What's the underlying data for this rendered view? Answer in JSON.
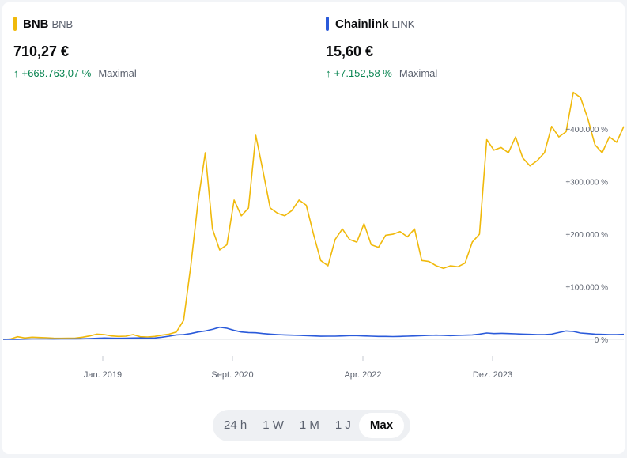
{
  "assets": [
    {
      "name": "BNB",
      "symbol": "BNB",
      "price": "710,27 €",
      "change": "+668.763,07 %",
      "period": "Maximal",
      "color": "#f0b90b"
    },
    {
      "name": "Chainlink",
      "symbol": "LINK",
      "price": "15,60 €",
      "change": "+7.152,58 %",
      "period": "Maximal",
      "color": "#2a5ada"
    }
  ],
  "ranges": [
    "24 h",
    "1 W",
    "1 M",
    "1 J",
    "Max"
  ],
  "active_range": "Max",
  "chart_data": {
    "type": "line",
    "x_tick_labels": [
      "Jan. 2019",
      "Sept. 2020",
      "Apr. 2022",
      "Dez. 2023"
    ],
    "y_tick_labels": [
      "0 %",
      "+100.000 %",
      "+200.000 %",
      "+300.000 %",
      "+400.000 %"
    ],
    "y_ticks": [
      0,
      100000,
      200000,
      300000,
      400000
    ],
    "ylim": [
      0,
      480000
    ],
    "grid": false,
    "series": [
      {
        "name": "BNB",
        "color": "#f0b90b",
        "values": [
          0,
          600,
          5000,
          2500,
          4000,
          3500,
          3000,
          2200,
          2000,
          2100,
          2400,
          4000,
          6500,
          10000,
          9000,
          6500,
          5500,
          6000,
          9000,
          5000,
          4500,
          5500,
          8000,
          10000,
          14000,
          36000,
          140000,
          262000,
          355000,
          210000,
          170000,
          180000,
          265000,
          235000,
          250000,
          388000,
          320000,
          250000,
          240000,
          235000,
          245000,
          265000,
          255000,
          200000,
          150000,
          140000,
          190000,
          210000,
          190000,
          185000,
          220000,
          180000,
          175000,
          198000,
          200000,
          205000,
          195000,
          210000,
          150000,
          148000,
          140000,
          135000,
          140000,
          138000,
          145000,
          185000,
          200000,
          380000,
          360000,
          365000,
          355000,
          385000,
          345000,
          330000,
          340000,
          355000,
          405000,
          385000,
          395000,
          470000,
          460000,
          420000,
          370000,
          355000,
          385000,
          375000,
          405000
        ]
      },
      {
        "name": "Chainlink",
        "color": "#2a5ada",
        "values": [
          0,
          0,
          200,
          500,
          800,
          800,
          700,
          600,
          700,
          800,
          900,
          1000,
          1400,
          2000,
          2600,
          2200,
          2000,
          2200,
          2500,
          2700,
          2300,
          2500,
          4000,
          6000,
          8500,
          9000,
          11000,
          14000,
          16000,
          19000,
          23000,
          21000,
          17000,
          14000,
          13000,
          12500,
          11000,
          10000,
          9000,
          8500,
          8000,
          7500,
          7000,
          6500,
          5800,
          6000,
          6000,
          6500,
          7000,
          7000,
          6500,
          6000,
          5500,
          5500,
          5200,
          5500,
          6000,
          6500,
          7000,
          7500,
          8000,
          7500,
          7000,
          7500,
          8000,
          8500,
          10000,
          12000,
          11000,
          11500,
          11000,
          10500,
          10000,
          9500,
          9000,
          9000,
          10000,
          13000,
          16000,
          15000,
          12000,
          11000,
          10000,
          9500,
          9000,
          9000,
          9500
        ]
      }
    ]
  }
}
